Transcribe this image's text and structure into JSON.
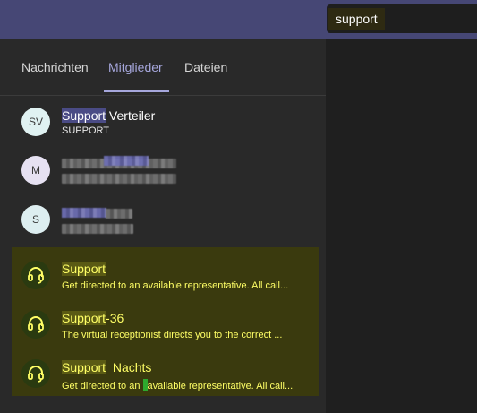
{
  "search": {
    "query": "support"
  },
  "tabs": [
    {
      "label": "Nachrichten",
      "active": false
    },
    {
      "label": "Mitglieder",
      "active": true
    },
    {
      "label": "Dateien",
      "active": false
    }
  ],
  "people": [
    {
      "initials": "SV",
      "name_highlight": "Support",
      "name_rest": " Verteiler",
      "subtitle": "SUPPORT"
    },
    {
      "initials": "M",
      "name_highlight": "",
      "name_rest": "",
      "subtitle": ""
    },
    {
      "initials": "S",
      "name_highlight": "",
      "name_rest": "",
      "subtitle": ""
    }
  ],
  "queues": [
    {
      "name_highlight": "Support",
      "name_rest": "",
      "description": "Get directed to an available representative. All call..."
    },
    {
      "name_highlight": "Support",
      "name_rest": "-36",
      "description": "The virtual receptionist directs you to the correct ..."
    },
    {
      "name_highlight": "Support",
      "name_rest": "_Nachts",
      "description_a": "Get directed to an ",
      "description_b": "available representative. All call..."
    }
  ],
  "colors": {
    "accent": "#a6a7dc",
    "highlight_text": "#ffff66",
    "titlebar": "#464775"
  }
}
